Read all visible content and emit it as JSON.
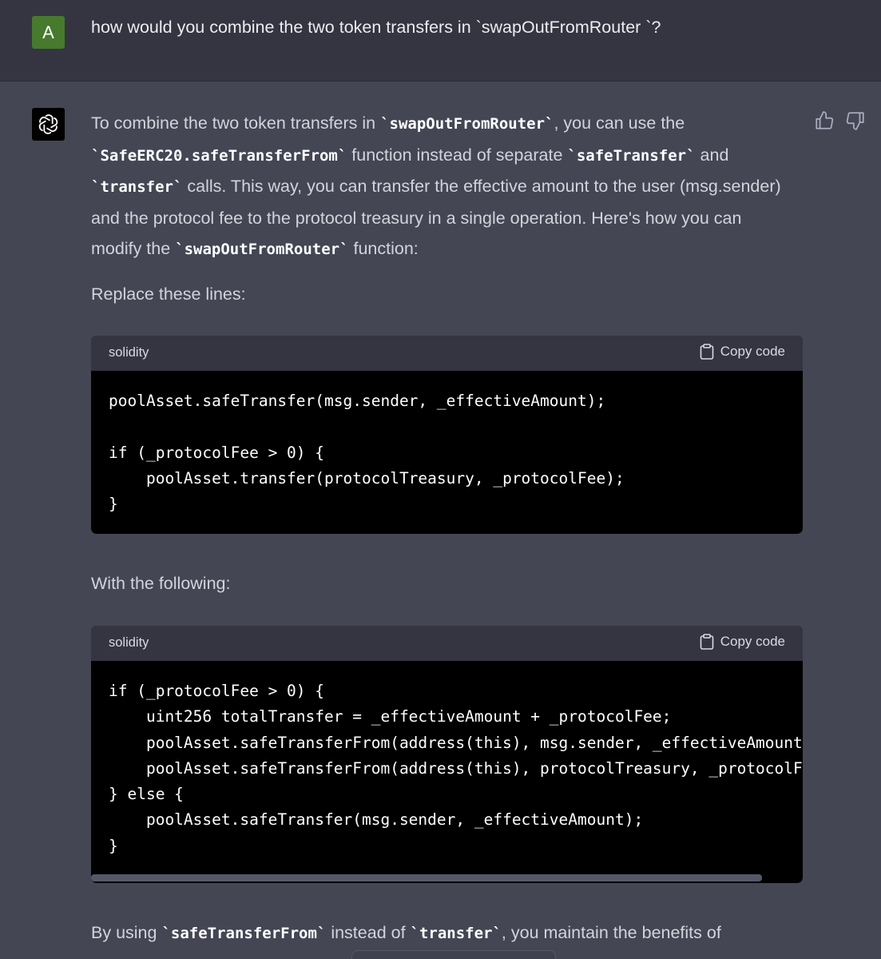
{
  "user": {
    "avatar_letter": "A",
    "message": "how would you combine the two token transfers in `swapOutFromRouter `?"
  },
  "assistant": {
    "p1": [
      {
        "t": "To combine the two token transfers in "
      },
      {
        "c": "`swapOutFromRouter`"
      },
      {
        "t": ", you can use the "
      },
      {
        "c": "`SafeERC20.safeTransferFrom`"
      },
      {
        "t": " function instead of separate "
      },
      {
        "c": "`safeTransfer`"
      },
      {
        "t": " and "
      },
      {
        "c": "`transfer`"
      },
      {
        "t": " calls. This way, you can transfer the effective amount to the user (msg.sender) and the protocol fee to the protocol treasury in a single operation. Here's how you can modify the "
      },
      {
        "c": "`swapOutFromRouter`"
      },
      {
        "t": " function:"
      }
    ],
    "p2": "Replace these lines:",
    "code1": {
      "lang": "solidity",
      "copy_label": "Copy code",
      "code": "poolAsset.safeTransfer(msg.sender, _effectiveAmount);\n\nif (_protocolFee > 0) {\n    poolAsset.transfer(protocolTreasury, _protocolFee);\n}"
    },
    "p3": "With the following:",
    "code2": {
      "lang": "solidity",
      "copy_label": "Copy code",
      "code": "if (_protocolFee > 0) {\n    uint256 totalTransfer = _effectiveAmount + _protocolFee;\n    poolAsset.safeTransferFrom(address(this), msg.sender, _effectiveAmount);\n    poolAsset.safeTransferFrom(address(this), protocolTreasury, _protocolFee);\n} else {\n    poolAsset.safeTransfer(msg.sender, _effectiveAmount);\n}"
    },
    "p4": [
      {
        "t": "By using "
      },
      {
        "c": "`safeTransferFrom`"
      },
      {
        "t": " instead of "
      },
      {
        "c": "`transfer`"
      },
      {
        "t": ", you maintain the benefits of"
      }
    ]
  }
}
